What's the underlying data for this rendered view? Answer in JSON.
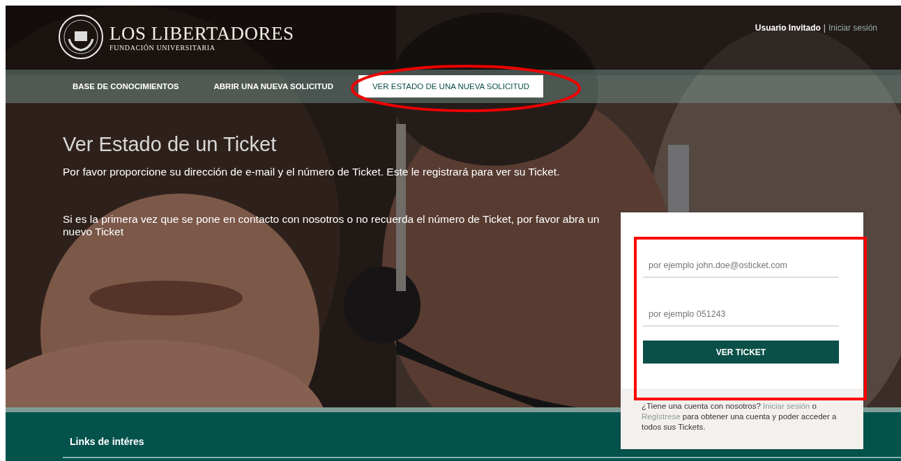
{
  "header": {
    "logo": {
      "name": "LOS LIBERTADORES",
      "subtitle": "FUNDACIÓN UNIVERSITARIA"
    },
    "user": {
      "label": "Usuario Invitado",
      "separator": "|",
      "link": "Iniciar sesión"
    }
  },
  "nav": {
    "tabs": [
      {
        "label": "BASE DE CONOCIMIENTOS",
        "selected": false
      },
      {
        "label": "ABRIR UNA NUEVA SOLICITUD",
        "selected": false
      },
      {
        "label": "VER ESTADO DE UNA NUEVA SOLICITUD",
        "selected": true
      }
    ]
  },
  "title": "Ver Estado de un Ticket",
  "paragraphs": [
    "Por favor proporcione su dirección de e-mail y el número de Ticket. Este le registrará para ver su Ticket.",
    "Si es la primera vez que se pone en contacto con nosotros o no recuerda el número de Ticket, por favor abra un nuevo Ticket"
  ],
  "form": {
    "fields": [
      {
        "placeholder": "por ejemplo john.doe@osticket.com"
      },
      {
        "placeholder": "por ejemplo 051243"
      }
    ],
    "button": "VER TICKET",
    "note": [
      {
        "kind": "text",
        "text": "¿Tiene una cuenta con nosotros? "
      },
      {
        "kind": "link",
        "text": "Iniciar sesión"
      },
      {
        "kind": "text",
        "text": " o "
      },
      {
        "kind": "link",
        "text": "Regístrese"
      },
      {
        "kind": "text",
        "text": " para obtener una cuenta y poder acceder a todos sus Tickets."
      }
    ]
  },
  "footer": {
    "heading": "Links de intéres"
  }
}
